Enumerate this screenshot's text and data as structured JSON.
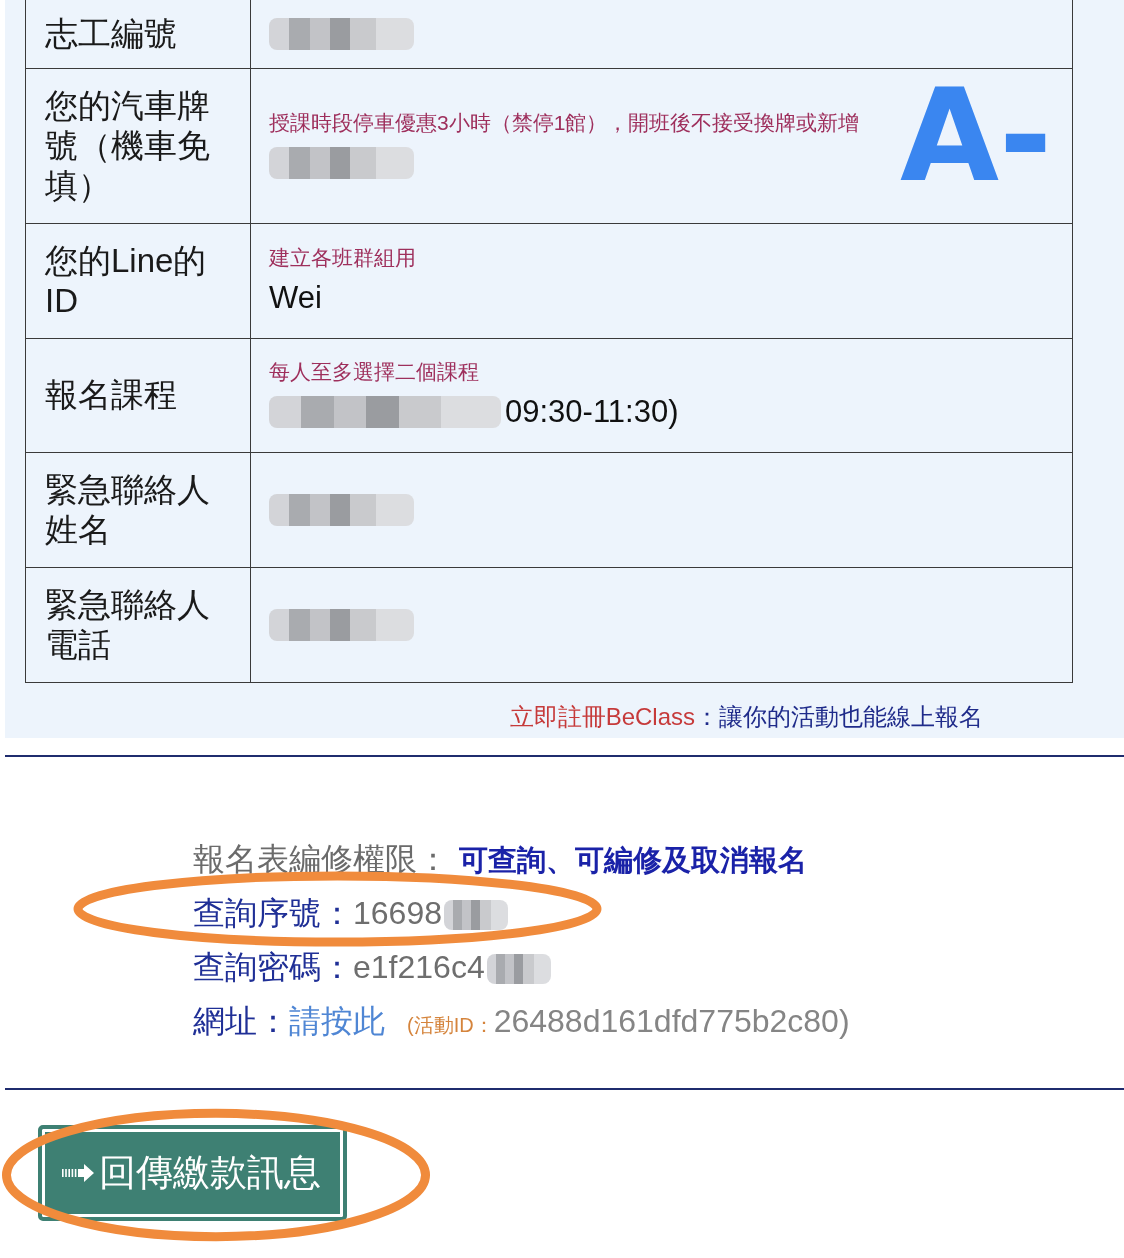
{
  "form_table": {
    "rows": [
      {
        "label": "志工編號",
        "redacted": true
      },
      {
        "label": "您的汽車牌號（機車免填）",
        "hint": "授課時段停車優惠3小時（禁停1館），開班後不接受換牌或新增",
        "redacted": true
      },
      {
        "label": "您的Line的ID",
        "hint": "建立各班群組用",
        "value": "Wei",
        "redacted": false
      },
      {
        "label": "報名課程",
        "hint": "每人至多選擇二個課程",
        "value": "09:30-11:30)",
        "redacted": true
      },
      {
        "label": "緊急聯絡人姓名",
        "redacted": true
      },
      {
        "label": "緊急聯絡人電話",
        "redacted": true
      }
    ]
  },
  "handwritten_mark": "A-",
  "signup_promo": {
    "link": "立即註冊BeClass",
    "text": "：讓你的活動也能線上報名"
  },
  "registration_info": {
    "permission": {
      "label": "報名表編修權限：",
      "value": "可查詢、可編修及取消報名"
    },
    "query_number": {
      "label": "查詢序號：",
      "value": "16698",
      "redacted": true,
      "circled": true
    },
    "query_password": {
      "label": "查詢密碼：",
      "value": "e1f216c4",
      "redacted": true
    },
    "url": {
      "label": "網址：",
      "link": "請按此",
      "event_id_label": "(活動ID：",
      "event_id": "26488d161dfd775b2c80)"
    }
  },
  "payment_button": {
    "label": "回傳繳款訊息",
    "circled": true
  }
}
